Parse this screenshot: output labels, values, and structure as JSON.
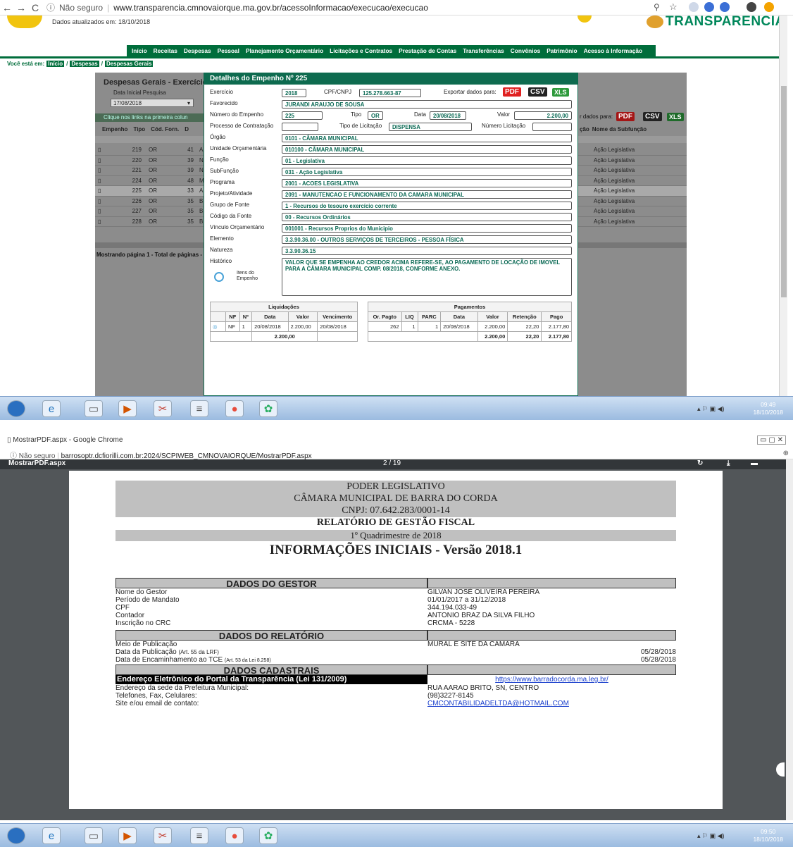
{
  "browser1": {
    "url_prefix": "Não seguro",
    "url": "www.transparencia.cmnovaiorque.ma.gov.br/acessoInformacao/execucao/execucao"
  },
  "site": {
    "updated": "Dados atualizados em: 18/10/2018",
    "brand": "TRANSPARÊNCIA",
    "menu": [
      "Início",
      "Receitas",
      "Despesas",
      "Pessoal",
      "Planejamento Orçamentário",
      "Licitações e Contratos",
      "Prestação de Contas",
      "Transferências",
      "Convênios",
      "Patrimônio",
      "Acesso à Informação"
    ],
    "breadcrumb_label": "Você está em:",
    "breadcrumb": [
      "Início",
      "Despesas",
      "Despesas Gerais"
    ]
  },
  "background_page": {
    "title": "Despesas Gerais - Exercício 201",
    "date_label": "Data Inicial Pesquisa",
    "date_value": "17/08/2018",
    "hint": "Clique nos links na primeira colun",
    "export_label": "r dados para:",
    "columns": [
      "Empenho",
      "Tipo",
      "Cód. Forn.",
      "D"
    ],
    "right_columns": [
      "ção",
      "Nome da Subfunção"
    ],
    "rows": [
      [
        "219",
        "OR",
        "41",
        "A",
        "Ação Legislativa"
      ],
      [
        "220",
        "OR",
        "39",
        "N.",
        "Ação Legislativa"
      ],
      [
        "221",
        "OR",
        "39",
        "N.",
        "Ação Legislativa"
      ],
      [
        "224",
        "OR",
        "48",
        "M",
        "Ação Legislativa"
      ],
      [
        "225",
        "OR",
        "33",
        "A",
        "Ação Legislativa"
      ],
      [
        "226",
        "OR",
        "35",
        "B",
        "Ação Legislativa"
      ],
      [
        "227",
        "OR",
        "35",
        "B",
        "Ação Legislativa"
      ],
      [
        "228",
        "OR",
        "35",
        "B",
        "Ação Legislativa"
      ]
    ],
    "footer": "Mostrando página 1 - Total de páginas -"
  },
  "modal": {
    "title": "Detalhes do Empenho Nº 225",
    "exercicio_label": "Exercício",
    "exercicio": "2018",
    "cpf_label": "CPF/CNPJ",
    "cpf": "125.278.663-87",
    "export_label": "Exportar dados para:",
    "pdf": "PDF",
    "csv": "CSV",
    "xls": "XLS",
    "favorecido_label": "Favorecido",
    "favorecido": "JURANDI ARAUJO DE SOUSA",
    "numero_label": "Número do Empenho",
    "numero": "225",
    "tipo_label": "Tipo",
    "tipo": "OR",
    "data_label": "Data",
    "data": "20/08/2018",
    "valor_label": "Valor",
    "valor": "2.200,00",
    "processo_label": "Processo de Contratação",
    "tipo_licit_label": "Tipo de Licitação",
    "tipo_licit": "DISPENSA",
    "num_licit_label": "Número Licitação",
    "orgao_label": "Órgão",
    "orgao": "0101 - CÂMARA MUNICIPAL",
    "unidade_label": "Unidade Orçamentária",
    "unidade": "010100 - CÂMARA MUNICIPAL",
    "funcao_label": "Função",
    "funcao": "01 - Legislativa",
    "subfuncao_label": "SubFunção",
    "subfuncao": "031 - Ação Legislativa",
    "programa_label": "Programa",
    "programa": "2001 - ACOES LEGISLATIVA",
    "projeto_label": "Projeto/Atividade",
    "projeto": "2091 - MANUTENCAO E FUNCIONAMENTO DA CAMARA MUNICIPAL",
    "grupo_label": "Grupo de Fonte",
    "grupo": "1 - Recursos do tesouro exercício corrente",
    "codigo_label": "Código da Fonte",
    "codigo": "00 - Recursos Ordinários",
    "vinculo_label": "Vínculo Orçamentário",
    "vinculo": "001001 - Recursos Proprios do Municipio",
    "elemento_label": "Elemento",
    "elemento": "3.3.90.36.00 - OUTROS SERVIÇOS DE TERCEIROS - PESSOA FÍSICA",
    "natureza_label": "Natureza",
    "natureza": "3.3.90.36.15",
    "historico_label": "Histórico",
    "historico": "VALOR QUE SE EMPENHA AO CREDOR ACIMA REFERE-SE, AO PAGAMENTO DE LOCAÇÃO DE IMOVEL PARA A CÂMARA MUNICIPAL COMP. 08/2018, CONFORME ANEXO.",
    "itens_label": "Itens do Empenho",
    "liquidacoes": {
      "title": "Liquidações",
      "headers": [
        "NF",
        "Nº",
        "Data",
        "Valor",
        "Vencimento"
      ],
      "row": [
        "NF",
        "1",
        "20/08/2018",
        "2.200,00",
        "20/08/2018"
      ],
      "total": "2.200,00"
    },
    "pagamentos": {
      "title": "Pagamentos",
      "headers": [
        "Or. Pagto",
        "LIQ",
        "PARC",
        "Data",
        "Valor",
        "Retenção",
        "Pago"
      ],
      "row": [
        "262",
        "1",
        "1",
        "20/08/2018",
        "2.200,00",
        "22,20",
        "2.177,80"
      ],
      "totals": [
        "2.200,00",
        "22,20",
        "2.177,80"
      ]
    }
  },
  "taskbar1": {
    "time": "09:49",
    "date": "18/10/2018"
  },
  "window2": {
    "title": "MostrarPDF.aspx - Google Chrome",
    "url_prefix": "Não seguro",
    "url": "barrosoptr.dcfiorilli.com.br:2024/SCPIWEB_CMNOVAIORQUE/MostrarPDF.aspx",
    "viewer_title": "MostrarPDF.aspx",
    "page_counter": "2 / 19"
  },
  "report": {
    "line1": "PODER LEGISLATIVO",
    "line2": "CÂMARA MUNICIPAL DE BARRA DO CORDA",
    "line3": "CNPJ: 07.642.283/0001-14",
    "line4": "RELATÓRIO DE GESTÃO FISCAL",
    "line5": "1º Quadrimestre de 2018",
    "line6": "INFORMAÇÕES INICIAIS - Versão 2018.1",
    "gestor_title": "DADOS DO GESTOR",
    "gestor": [
      [
        "Nome do Gestor",
        "GILVAN JOSÉ OLIVEIRA PEREIRA"
      ],
      [
        "Período de Mandato",
        "01/01/2017 a 31/12/2018"
      ],
      [
        "CPF",
        "344.194.033-49"
      ],
      [
        "Contador",
        "ANTONIO BRAZ DA SILVA FILHO"
      ],
      [
        "Inscrição no CRC",
        "CRCMA - 5228"
      ]
    ],
    "relatorio_title": "DADOS DO RELATÓRIO",
    "meio_label": "Meio de Publicação",
    "meio": "MURAL E SITE DA CAMARA",
    "data_pub_label": "Data da Publicação",
    "data_pub_note": "(Art. 55 da LRF)",
    "data_pub": "05/28/2018",
    "data_enc_label": "Data de Encaminhamento ao TCE",
    "data_enc_note": "(Art. 53 da Lei 8.258)",
    "data_enc": "05/28/2018",
    "cadastrais_title": "DADOS CADASTRAIS",
    "portal_label": "Endereço Eletrônico do Portal da Transparência (Lei 131/2009)",
    "portal": "https://www.barradocorda.ma.leg.br/",
    "sede_label": "Endereço da sede da Prefeitura Municipal:",
    "sede": "RUA AARAO BRITO, SN, CENTRO",
    "fone_label": "Telefones, Fax, Celulares:",
    "fone": "(98)3227-8145",
    "site_label": "Site e/ou email de contato:",
    "site": "CMCONTABILIDADELTDA@HOTMAIL.COM"
  },
  "taskbar2": {
    "time": "09:50",
    "date": "18/10/2018"
  }
}
